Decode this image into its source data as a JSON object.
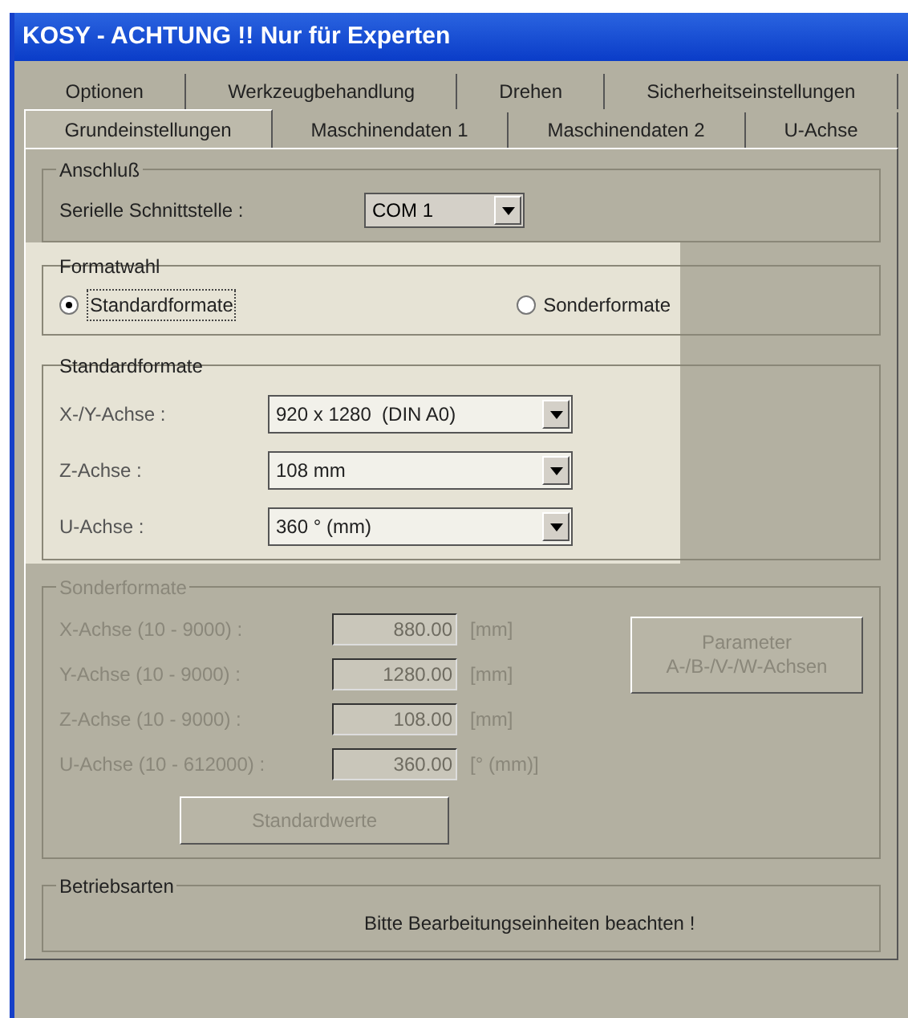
{
  "window": {
    "title": "KOSY - ACHTUNG !!  Nur für Experten"
  },
  "tab_rows": [
    [
      {
        "label": "Optionen",
        "selected": false
      },
      {
        "label": "Werkzeugbehandlung",
        "selected": false
      },
      {
        "label": "Drehen",
        "selected": false
      },
      {
        "label": "Sicherheitseinstellungen",
        "selected": false
      }
    ],
    [
      {
        "label": "Grundeinstellungen",
        "selected": true
      },
      {
        "label": "Maschinendaten 1",
        "selected": false
      },
      {
        "label": "Maschinendaten 2",
        "selected": false
      },
      {
        "label": "U-Achse",
        "selected": false
      }
    ]
  ],
  "anschluss": {
    "title": "Anschluß",
    "label": "Serielle Schnittstelle :",
    "value": "COM 1"
  },
  "formatwahl": {
    "title": "Formatwahl",
    "options": [
      {
        "label": "Standardformate",
        "selected": true
      },
      {
        "label": "Sonderformate",
        "selected": false
      }
    ]
  },
  "standardformate": {
    "title": "Standardformate",
    "rows": [
      {
        "label": "X-/Y-Achse :",
        "value": "920 x 1280  (DIN A0)"
      },
      {
        "label": "Z-Achse :",
        "value": "108 mm"
      },
      {
        "label": "U-Achse :",
        "value": "360 ° (mm)"
      }
    ]
  },
  "sonderformate": {
    "title": "Sonderformate",
    "disabled": true,
    "rows": [
      {
        "label": "X-Achse (10 - 9000) :",
        "value": "880.00",
        "unit": "[mm]"
      },
      {
        "label": "Y-Achse (10 - 9000) :",
        "value": "1280.00",
        "unit": "[mm]"
      },
      {
        "label": "Z-Achse (10 - 9000) :",
        "value": "108.00",
        "unit": "[mm]"
      },
      {
        "label": "U-Achse (10 - 612000) :",
        "value": "360.00",
        "unit": "[° (mm)]"
      }
    ],
    "parameter_button": "Parameter\nA-/B-/V-/W-Achsen",
    "default_button": "Standardwerte"
  },
  "betriebsarten": {
    "title": "Betriebsarten",
    "note": "Bitte Bearbeitungseinheiten beachten !"
  }
}
